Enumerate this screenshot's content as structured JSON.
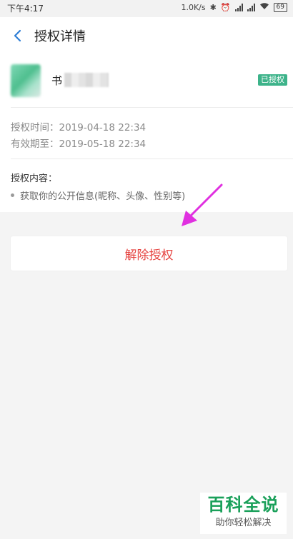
{
  "status_bar": {
    "time": "下午4:17",
    "network_speed": "1.0K/s",
    "battery": "69"
  },
  "header": {
    "title": "授权详情"
  },
  "app": {
    "name": "书",
    "badge": "已授权",
    "badge_color": "#3db38a"
  },
  "details": {
    "auth_time": "授权时间：2019-04-18 22:34",
    "valid_until": "有效期至：2019-05-18 22:34"
  },
  "scope": {
    "title": "授权内容：",
    "items": [
      "获取你的公开信息(昵称、头像、性别等)"
    ]
  },
  "revoke": {
    "label": "解除授权",
    "color": "#e64340"
  },
  "annotation": {
    "arrow_color": "#e030e0"
  },
  "watermark": {
    "title": "百科全说",
    "subtitle": "助你轻松解决"
  }
}
